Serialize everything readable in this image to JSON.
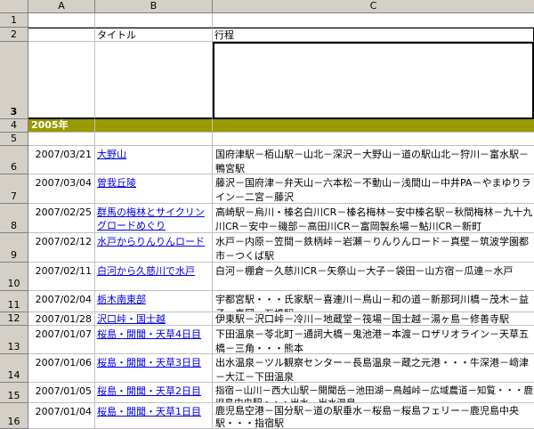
{
  "columns": [
    "A",
    "B",
    "C"
  ],
  "row_numbers": [
    "1",
    "2",
    "3",
    "4",
    "5",
    "6",
    "7",
    "8",
    "9",
    "10",
    "11",
    "12",
    "13",
    "14",
    "15",
    "16"
  ],
  "header": {
    "title_label": "タイトル",
    "route_label": "行程"
  },
  "year_label": "2005年",
  "entries": [
    {
      "date": "2007/03/21",
      "title": "大野山",
      "route": "国府津駅－栢山駅－山北－深沢－大野山－道の駅山北－狩川－富水駅－鴨宮駅"
    },
    {
      "date": "2007/03/04",
      "title": "曽我丘陵",
      "route": "藤沢－国府津－弁天山－六本松－不動山－浅間山－中井PA－やまゆりライン－二宮－藤沢"
    },
    {
      "date": "2007/02/25",
      "title": "群馬の梅林とサイクリングロードめぐり",
      "route": "高崎駅－烏川・榛名白川CR－榛名梅林－安中榛名駅－秋間梅林－九十九川CR－安中－磯部－高田川CR－富岡製糸場－鮎川CR－新町"
    },
    {
      "date": "2007/02/12",
      "title": "水戸からりんりんロード",
      "route": "水戸－内原－笠間－鉄柄峠－岩瀬－りんりんロード－真壁－筑波学園都市－つくば駅"
    },
    {
      "date": "2007/02/11",
      "title": "白河から久慈川で水戸",
      "route": "白河－棚倉－久慈川CR－矢祭山－大子－袋田－山方宿－瓜連－水戸"
    },
    {
      "date": "2007/02/04",
      "title": "栃木南東部",
      "route": "宇都宮駅・・・氏家駅－喜連川－鳥山－和の道－新那珂川橋－茂木－益子－真岡－石橋駅"
    },
    {
      "date": "2007/01/28",
      "title": "沢口峠・国士越",
      "route": "伊東駅－沢口峠－冷川－地蔵堂－筏場－国士越－湯ヶ島－修善寺駅"
    },
    {
      "date": "2007/01/07",
      "title": "桜島・開聞・天草4日目",
      "route": "下田温泉－苓北町－通詞大橋－鬼池港－本渡－ロザリオライン－天草五橋－三角・・・熊本"
    },
    {
      "date": "2007/01/06",
      "title": "桜島・開聞・天草3日目",
      "route": "出水温泉－ツル観察センター－長島温泉－蔵之元港・・・牛深港－﨑津－大江－下田温泉"
    },
    {
      "date": "2007/01/05",
      "title": "桜島・開聞・天草2日目",
      "route": "指宿－山川－西大山駅－開聞岳－池田湖－鳥越峠－広域農道－知覧・・・鹿児島中央駅・・・出水－出水温泉"
    },
    {
      "date": "2007/01/04",
      "title": "桜島・開聞・天草1日目",
      "route": "鹿児島空港－国分駅－道の駅垂水－桜島－桜島フェリー－鹿児島中央駅・・・指宿駅"
    }
  ],
  "colors": {
    "year_band": "#999900",
    "link": "#0000ee",
    "header_bg": "#d4d0c8"
  }
}
